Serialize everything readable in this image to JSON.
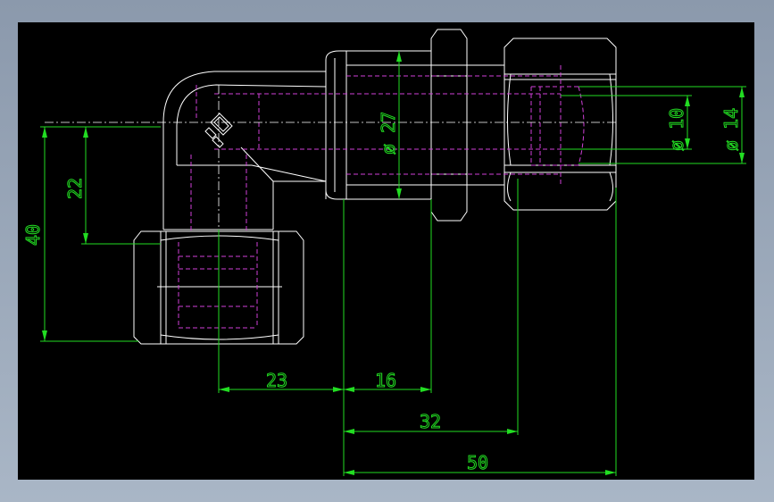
{
  "dimensions": {
    "d23": "23",
    "d16": "16",
    "d32": "32",
    "d50": "50",
    "d40": "40",
    "d22": "22",
    "dia27": "ø 27",
    "dia10": "ø 10",
    "dia14": "ø 14"
  },
  "colors": {
    "background": "#000000",
    "outline": "#ffffff",
    "hidden": "#d040d8",
    "dimension": "#22dd22",
    "frame": "#8b99ac"
  }
}
